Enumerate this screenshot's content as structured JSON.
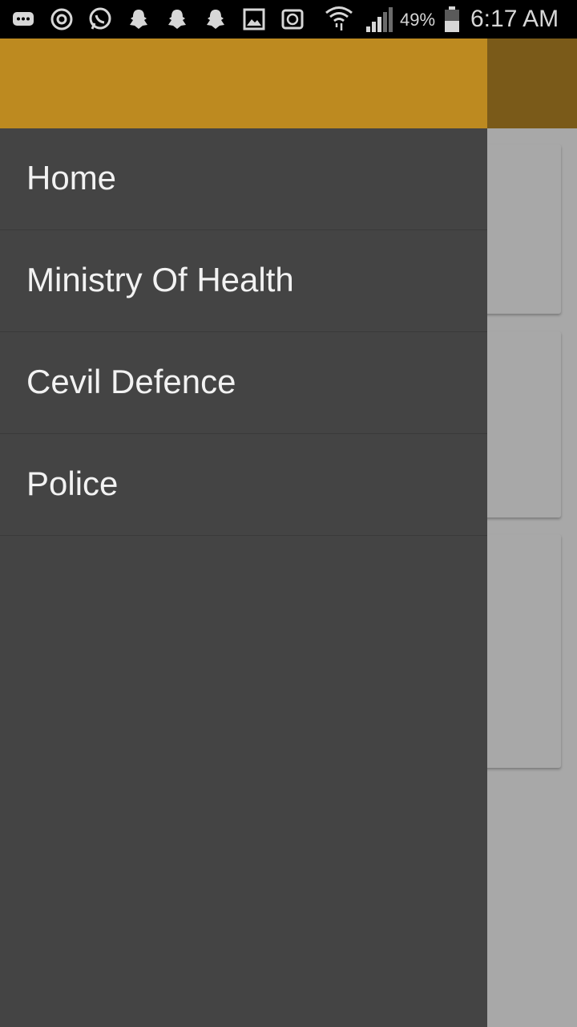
{
  "status_bar": {
    "battery_percent": "49%",
    "time": "6:17 AM",
    "icons": [
      "messages-icon",
      "sync-icon",
      "whatsapp-icon",
      "snapchat-icon",
      "snapchat-icon",
      "snapchat-icon",
      "gallery-icon",
      "money-icon",
      "wifi-icon",
      "signal-icon",
      "battery-icon"
    ]
  },
  "colors": {
    "drawer_header": "#bd8a20",
    "drawer_background": "#444444",
    "app_bar_dimmed": "#7a5a19",
    "scrim_content": "#a8a8a8"
  },
  "drawer": {
    "items": [
      {
        "label": "Home"
      },
      {
        "label": "Ministry Of Health"
      },
      {
        "label": "Cevil Defence"
      },
      {
        "label": "Police"
      }
    ]
  }
}
